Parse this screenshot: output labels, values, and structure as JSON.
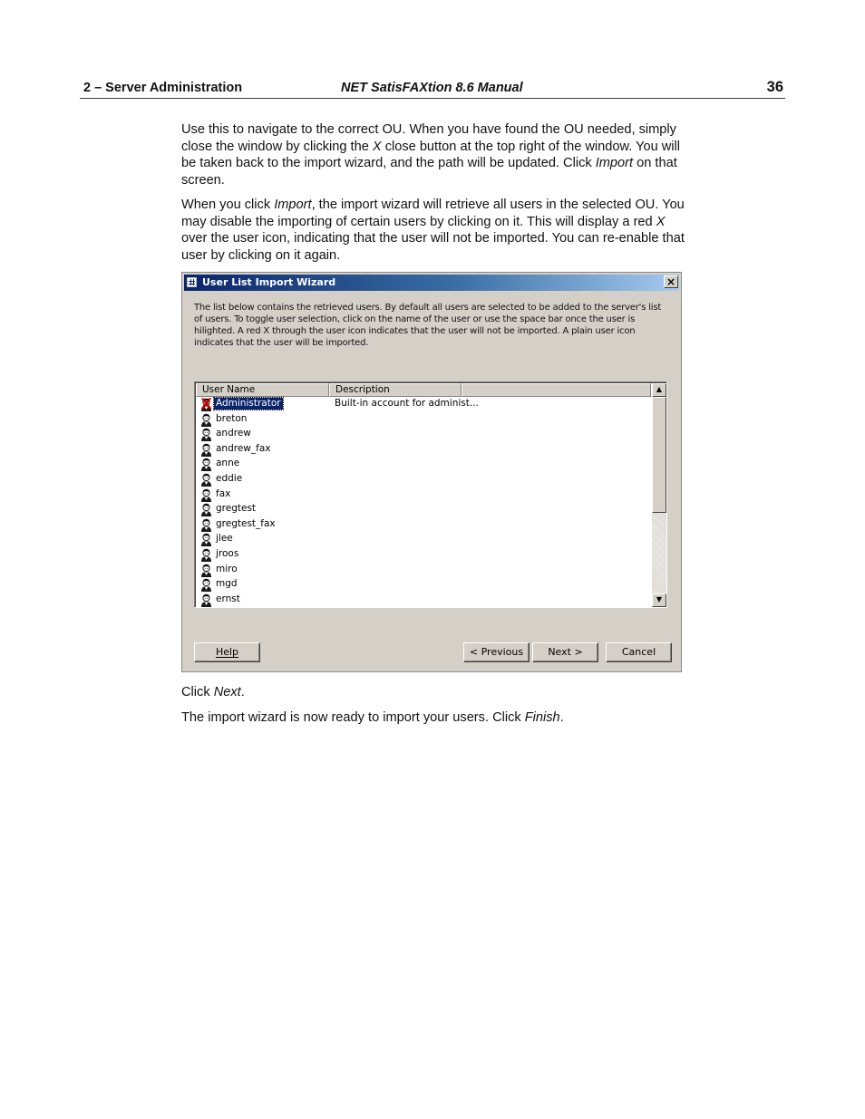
{
  "header": {
    "section": "2  – Server Administration",
    "manual_title": "NET SatisFAXtion 8.6 Manual",
    "page_number": "36"
  },
  "paragraphs": {
    "p1": {
      "a": "Use this to navigate to the correct OU. When you have found the OU needed, simply close the window by clicking the ",
      "b": "X",
      "c": " close button at the top right of the window. You will be taken back to the import wizard, and the path will be updated. Click ",
      "d": "Import",
      "e": " on that screen."
    },
    "p2": {
      "a": "When you click ",
      "b": "Import",
      "c": ", the import wizard will retrieve all users in the selected OU. You may disable the importing of certain users by clicking on it. This will display a red ",
      "d": "X",
      "e": " over the user icon, indicating that the user will not be imported. You can re-enable that user by clicking on it again."
    },
    "p3": {
      "a": "Click ",
      "b": "Next",
      "c": "."
    },
    "p4": {
      "a": "The import wizard is now ready to import your users. Click ",
      "b": "Finish",
      "c": "."
    }
  },
  "dialog": {
    "title": "User List Import Wizard",
    "close_glyph": "×",
    "intro": "The list below contains the retrieved users.  By default all users are selected to be added to the server's list of users.  To toggle user selection, click on the name of the user or use the space bar once the user is hilighted.  A red X through the user icon indicates that the user will not be imported.  A plain user icon indicates that the user will be imported.",
    "columns": {
      "user": "User Name",
      "desc": "Description"
    },
    "users": [
      {
        "name": "Administrator",
        "desc": "Built-in account for administ..."
      },
      {
        "name": "breton",
        "desc": ""
      },
      {
        "name": "andrew",
        "desc": ""
      },
      {
        "name": "andrew_fax",
        "desc": ""
      },
      {
        "name": "anne",
        "desc": ""
      },
      {
        "name": "eddie",
        "desc": ""
      },
      {
        "name": "fax",
        "desc": ""
      },
      {
        "name": "gregtest",
        "desc": ""
      },
      {
        "name": "gregtest_fax",
        "desc": ""
      },
      {
        "name": "jlee",
        "desc": ""
      },
      {
        "name": "jroos",
        "desc": ""
      },
      {
        "name": "miro",
        "desc": ""
      },
      {
        "name": "mgd",
        "desc": ""
      },
      {
        "name": "ernst",
        "desc": ""
      }
    ],
    "excluded_mark": "X",
    "scroll_up_glyph": "▲",
    "scroll_down_glyph": "▼",
    "buttons": {
      "help": "Help",
      "previous": "< Previous",
      "next": "Next >",
      "cancel": "Cancel"
    }
  }
}
